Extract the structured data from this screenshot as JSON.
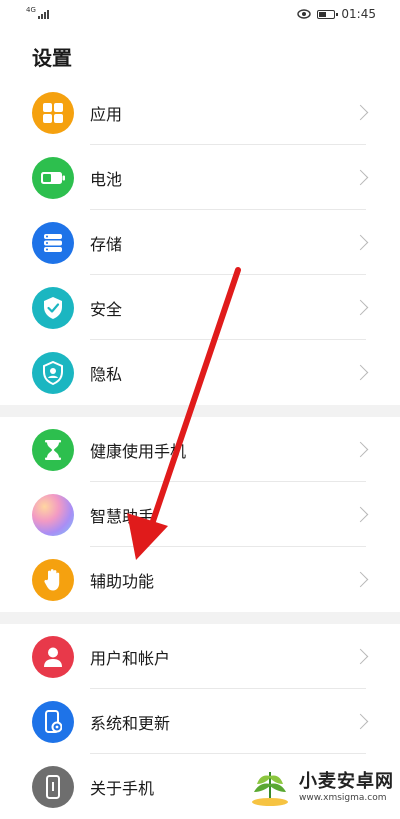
{
  "status_bar": {
    "network": "4G",
    "time": "01:45",
    "battery_level": 0.55
  },
  "page": {
    "title": "设置"
  },
  "groups": [
    [
      {
        "id": "apps",
        "label": "应用",
        "icon": "apps-grid-icon",
        "color": "#F5A10F"
      },
      {
        "id": "battery",
        "label": "电池",
        "icon": "battery-icon",
        "color": "#2DBF4E"
      },
      {
        "id": "storage",
        "label": "存储",
        "icon": "storage-icon",
        "color": "#1E73E8"
      },
      {
        "id": "security",
        "label": "安全",
        "icon": "shield-check-icon",
        "color": "#1BB6C1"
      },
      {
        "id": "privacy",
        "label": "隐私",
        "icon": "privacy-shield-icon",
        "color": "#1BB6C1"
      }
    ],
    [
      {
        "id": "digital-balance",
        "label": "健康使用手机",
        "icon": "hourglass-icon",
        "color": "#2DBF4E"
      },
      {
        "id": "smart-assistant",
        "label": "智慧助手",
        "icon": "smart-assistant-icon",
        "color": "#c9a0e8"
      },
      {
        "id": "accessibility",
        "label": "辅助功能",
        "icon": "hand-icon",
        "color": "#F5A10F"
      }
    ],
    [
      {
        "id": "users",
        "label": "用户和帐户",
        "icon": "user-icon",
        "color": "#E8394A"
      },
      {
        "id": "system",
        "label": "系统和更新",
        "icon": "phone-gear-icon",
        "color": "#1E73E8"
      },
      {
        "id": "about",
        "label": "关于手机",
        "icon": "phone-info-icon",
        "color": "#6E6E6E"
      }
    ]
  ],
  "watermark": {
    "title": "小麦安卓网",
    "url": "www.xmsigma.com"
  },
  "annotation": {
    "arrow_color": "#E01B1B"
  }
}
